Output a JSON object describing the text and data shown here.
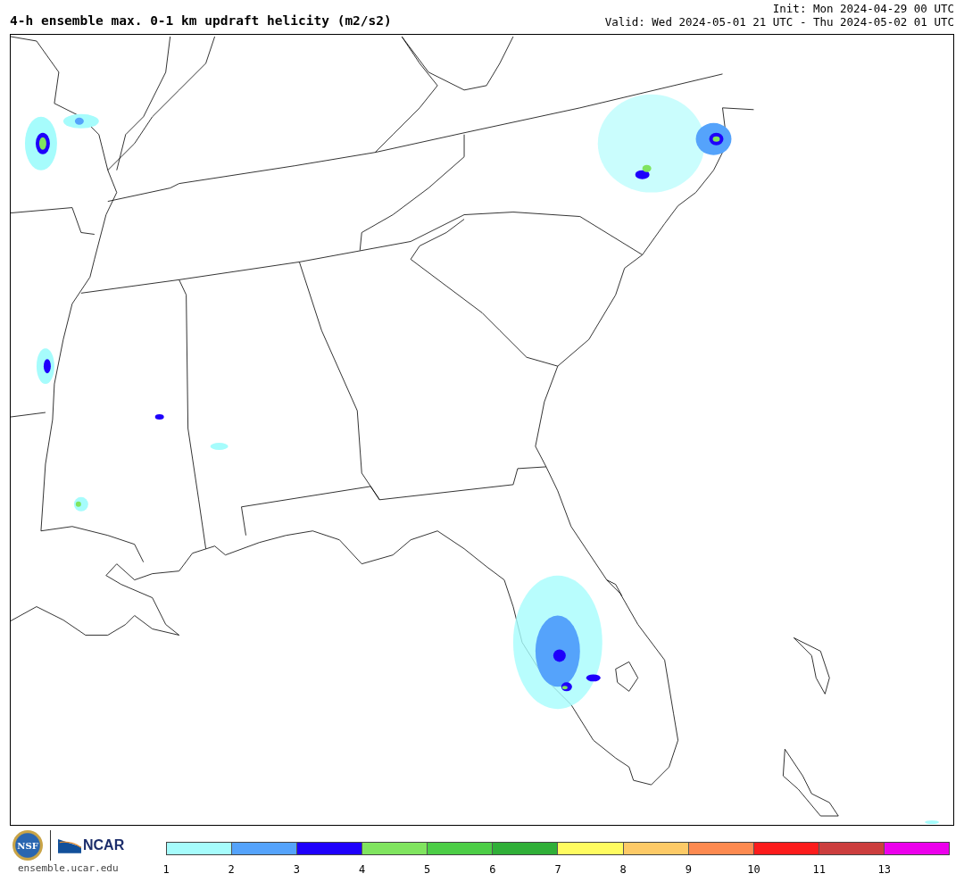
{
  "title": "4-h ensemble max. 0-1 km updraft helicity (m2/s2)",
  "init": "Init: Mon 2024-04-29 00 UTC",
  "valid": "Valid: Wed 2024-05-01 21 UTC - Thu 2024-05-02 01 UTC",
  "logos": {
    "nsf": "NSF",
    "ncar": "NCAR",
    "url": "ensemble.ucar.edu"
  },
  "colorbar": {
    "bins": [
      {
        "color": "#a6fcfc"
      },
      {
        "color": "#55a3fb"
      },
      {
        "color": "#1e00fb"
      },
      {
        "color": "#80e45f"
      },
      {
        "color": "#4ccd46"
      },
      {
        "color": "#30af38"
      },
      {
        "color": "#fffc60"
      },
      {
        "color": "#fdca67"
      },
      {
        "color": "#fd8a50"
      },
      {
        "color": "#fc1c1c"
      },
      {
        "color": "#cc3e3e"
      },
      {
        "color": "#ec00ec"
      }
    ],
    "ticks": [
      "1",
      "2",
      "3",
      "4",
      "5",
      "6",
      "7",
      "8",
      "9",
      "10",
      "11",
      "13"
    ]
  }
}
